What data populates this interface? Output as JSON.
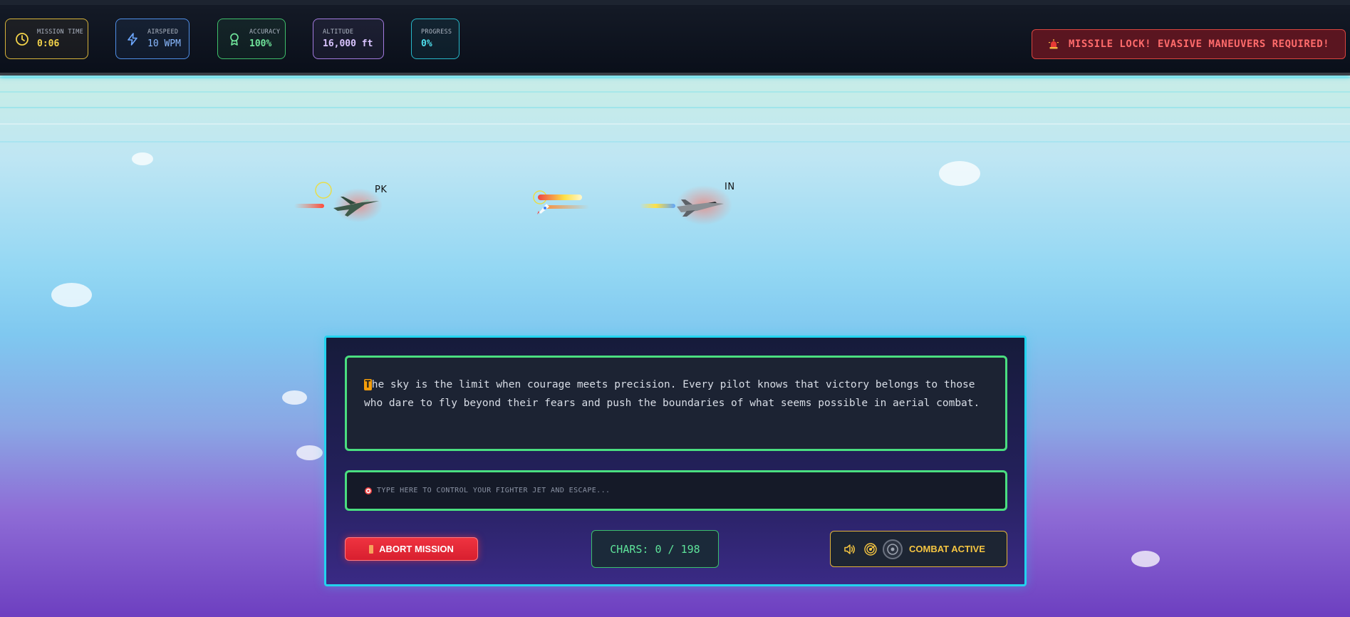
{
  "hud": {
    "mission_time": {
      "label": "MISSION TIME",
      "value": "0:06",
      "icon": "clock-icon"
    },
    "airspeed": {
      "label": "AIRSPEED",
      "value": "10 WPM",
      "icon": "lightning-icon"
    },
    "accuracy": {
      "label": "ACCURACY",
      "value": "100%",
      "icon": "award-icon"
    },
    "altitude": {
      "label": "ALTITUDE",
      "value": "16,000 ft"
    },
    "progress": {
      "label": "PROGRESS",
      "value": "0%",
      "fraction": 0
    },
    "alert": {
      "icon": "siren-icon",
      "text": "MISSILE LOCK! EVASIVE MANEUVERS REQUIRED!"
    }
  },
  "scene": {
    "player_jet": {
      "label": "PK"
    },
    "enemy_jet": {
      "label": "IN"
    },
    "missile": {
      "icon": "rocket-icon"
    }
  },
  "typing": {
    "current_char": "T",
    "remaining_text": "he sky is the limit when courage meets precision. Every pilot knows that victory belongs to those who dare to fly beyond their fears and push the boundaries of what seems possible in aerial combat.",
    "input_icon": "target-icon",
    "input_placeholder": "Type here to control your fighter jet and escape...",
    "input_value": ""
  },
  "controls": {
    "abort_label": "ABORT MISSION",
    "chars_label": "CHARS: 0 / 198",
    "combat_label": "COMBAT ACTIVE"
  },
  "colors": {
    "accent_cyan": "#22d3ee",
    "accent_green": "#4ade80",
    "alert_red": "#ef3340",
    "highlight_amber": "#f59e0b"
  }
}
